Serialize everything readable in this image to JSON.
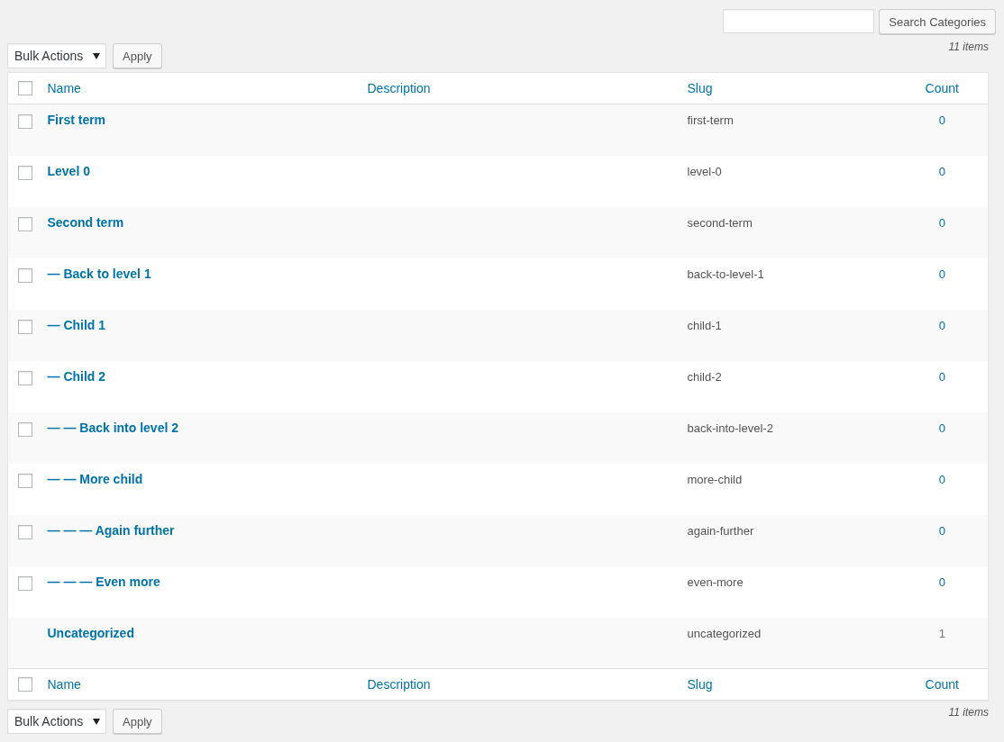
{
  "search": {
    "button": "Search Categories"
  },
  "top_nav": {
    "bulk_actions": "Bulk Actions",
    "apply": "Apply",
    "items_count": "11 items"
  },
  "header": {
    "checked": false,
    "columns": [
      "Name",
      "Description",
      "Slug",
      "Count"
    ]
  },
  "rows": [
    {
      "kind": "term",
      "checked": false,
      "name": "First term",
      "slug": "first-term",
      "count": "0"
    },
    {
      "kind": "term",
      "checked": false,
      "name": "Level 0",
      "slug": "level-0",
      "count": "0"
    },
    {
      "kind": "term",
      "checked": false,
      "name": "Second term",
      "slug": "second-term",
      "count": "0"
    },
    {
      "kind": "term",
      "checked": false,
      "name": "— Back to level 1",
      "slug": "back-to-level-1",
      "count": "0"
    },
    {
      "kind": "term",
      "checked": false,
      "name": "— Child 1",
      "slug": "child-1",
      "count": "0"
    },
    {
      "kind": "term",
      "checked": false,
      "name": "— Child 2",
      "slug": "child-2",
      "count": "0"
    },
    {
      "kind": "term",
      "checked": false,
      "name": "— — Back into level 2",
      "slug": "back-into-level-2",
      "count": "0"
    },
    {
      "kind": "term",
      "checked": false,
      "name": "— — More child",
      "slug": "more-child",
      "count": "0"
    },
    {
      "kind": "term",
      "checked": false,
      "name": "— — — Again further",
      "slug": "again-further",
      "count": "0"
    },
    {
      "kind": "term",
      "checked": false,
      "name": "— — — Even more",
      "slug": "even-more",
      "count": "0"
    },
    {
      "kind": "default",
      "name": "Uncategorized",
      "slug": "uncategorized",
      "count": "1"
    }
  ],
  "footer": {
    "checked": false,
    "columns": [
      "Name",
      "Description",
      "Slug",
      "Count"
    ]
  },
  "bottom_nav": {
    "bulk_actions": "Bulk Actions",
    "apply": "Apply",
    "items_count": "11 items"
  }
}
